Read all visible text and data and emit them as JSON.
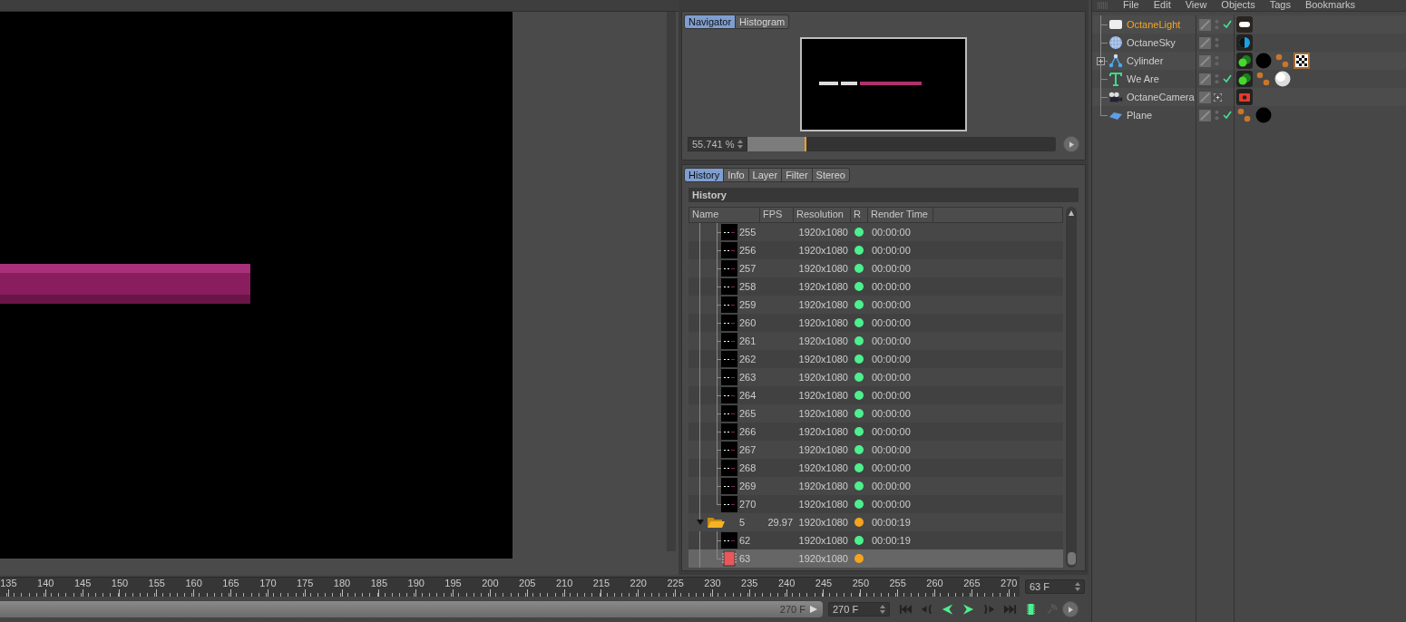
{
  "navigator": {
    "tabs": [
      {
        "label": "Navigator",
        "selected": true
      },
      {
        "label": "Histogram",
        "selected": false
      }
    ],
    "zoom_value": "55.741 %",
    "zoom_slider": {
      "level": 0.19
    }
  },
  "history": {
    "tabs": [
      {
        "label": "History",
        "selected": true
      },
      {
        "label": "Info",
        "selected": false
      },
      {
        "label": "Layer",
        "selected": false
      },
      {
        "label": "Filter",
        "selected": false
      },
      {
        "label": "Stereo",
        "selected": false
      }
    ],
    "title": "History",
    "columns": [
      "Name",
      "FPS",
      "Resolution",
      "R",
      "Render Time"
    ],
    "rows": [
      {
        "kind": "continued",
        "children": [
          {
            "kind": "frame",
            "name": "255",
            "resolution": "1920x1080",
            "color": "#4cf08e",
            "render_time": "00:00:00",
            "selected": false
          },
          {
            "kind": "frame",
            "name": "256",
            "resolution": "1920x1080",
            "color": "#4cf08e",
            "render_time": "00:00:00",
            "selected": false
          },
          {
            "kind": "frame",
            "name": "257",
            "resolution": "1920x1080",
            "color": "#4cf08e",
            "render_time": "00:00:00",
            "selected": false
          },
          {
            "kind": "frame",
            "name": "258",
            "resolution": "1920x1080",
            "color": "#4cf08e",
            "render_time": "00:00:00",
            "selected": false
          },
          {
            "kind": "frame",
            "name": "259",
            "resolution": "1920x1080",
            "color": "#4cf08e",
            "render_time": "00:00:00",
            "selected": false
          },
          {
            "kind": "frame",
            "name": "260",
            "resolution": "1920x1080",
            "color": "#4cf08e",
            "render_time": "00:00:00",
            "selected": false
          },
          {
            "kind": "frame",
            "name": "261",
            "resolution": "1920x1080",
            "color": "#4cf08e",
            "render_time": "00:00:00",
            "selected": false
          },
          {
            "kind": "frame",
            "name": "262",
            "resolution": "1920x1080",
            "color": "#4cf08e",
            "render_time": "00:00:00",
            "selected": false
          },
          {
            "kind": "frame",
            "name": "263",
            "resolution": "1920x1080",
            "color": "#4cf08e",
            "render_time": "00:00:00",
            "selected": false
          },
          {
            "kind": "frame",
            "name": "264",
            "resolution": "1920x1080",
            "color": "#4cf08e",
            "render_time": "00:00:00",
            "selected": false
          },
          {
            "kind": "frame",
            "name": "265",
            "resolution": "1920x1080",
            "color": "#4cf08e",
            "render_time": "00:00:00",
            "selected": false
          },
          {
            "kind": "frame",
            "name": "266",
            "resolution": "1920x1080",
            "color": "#4cf08e",
            "render_time": "00:00:00",
            "selected": false
          },
          {
            "kind": "frame",
            "name": "267",
            "resolution": "1920x1080",
            "color": "#4cf08e",
            "render_time": "00:00:00",
            "selected": false
          },
          {
            "kind": "frame",
            "name": "268",
            "resolution": "1920x1080",
            "color": "#4cf08e",
            "render_time": "00:00:00",
            "selected": false
          },
          {
            "kind": "frame",
            "name": "269",
            "resolution": "1920x1080",
            "color": "#4cf08e",
            "render_time": "00:00:00",
            "selected": false
          },
          {
            "kind": "frame",
            "name": "270",
            "resolution": "1920x1080",
            "color": "#4cf08e",
            "render_time": "00:00:00",
            "selected": false
          }
        ]
      },
      {
        "kind": "folder",
        "name": "5",
        "fps": "29.97",
        "resolution": "1920x1080",
        "color": "#f5a41f",
        "render_time": "00:00:19",
        "expanded": true,
        "selected": false,
        "children": [
          {
            "kind": "frame",
            "name": "62",
            "resolution": "1920x1080",
            "color": "#4cf08e",
            "render_time": "00:00:19",
            "selected": false
          },
          {
            "kind": "rendering",
            "name": "63",
            "resolution": "1920x1080",
            "color": "#f5a41f",
            "selected": true
          }
        ]
      }
    ]
  },
  "timeline": {
    "range_bar": {
      "level": 1
    },
    "ruler_labels": [
      "135",
      "140",
      "145",
      "150",
      "155",
      "160",
      "165",
      "170",
      "175",
      "180",
      "185",
      "190",
      "195",
      "200",
      "205",
      "210",
      "215",
      "220",
      "225",
      "230",
      "235",
      "240",
      "245",
      "250",
      "255",
      "260",
      "265",
      "270"
    ],
    "current_frame": "63 F",
    "range_end": "270 F",
    "end_frame": "270 F"
  },
  "object_manager": {
    "menu": [
      "File",
      "Edit",
      "View",
      "Objects",
      "Tags",
      "Bookmarks"
    ],
    "objects": [
      {
        "name": "OctaneLight",
        "kind": "light",
        "selected": true,
        "checked": true,
        "tags": [
          {
            "kind": "octane-light"
          }
        ]
      },
      {
        "name": "OctaneSky",
        "kind": "sky",
        "selected": false,
        "checked": false,
        "tags": [
          {
            "kind": "octane-sky"
          }
        ]
      },
      {
        "name": "Cylinder",
        "kind": "cylinder",
        "selected": false,
        "checked": false,
        "expanded": false,
        "tags": [
          {
            "kind": "octane-object"
          },
          {
            "kind": "material-black"
          },
          {
            "kind": "material-dots"
          },
          {
            "kind": "material-checker"
          }
        ]
      },
      {
        "name": "We Are",
        "kind": "text",
        "selected": false,
        "checked": true,
        "tags": [
          {
            "kind": "octane-object"
          },
          {
            "kind": "material-dots"
          },
          {
            "kind": "material-white"
          }
        ]
      },
      {
        "name": "OctaneCamera",
        "kind": "camera",
        "selected": false,
        "checked": false,
        "tags": [
          {
            "kind": "octane-camera"
          }
        ]
      },
      {
        "name": "Plane",
        "kind": "plane",
        "selected": false,
        "checked": true,
        "tags": [
          {
            "kind": "material-dots"
          },
          {
            "kind": "material-black"
          }
        ]
      }
    ]
  }
}
